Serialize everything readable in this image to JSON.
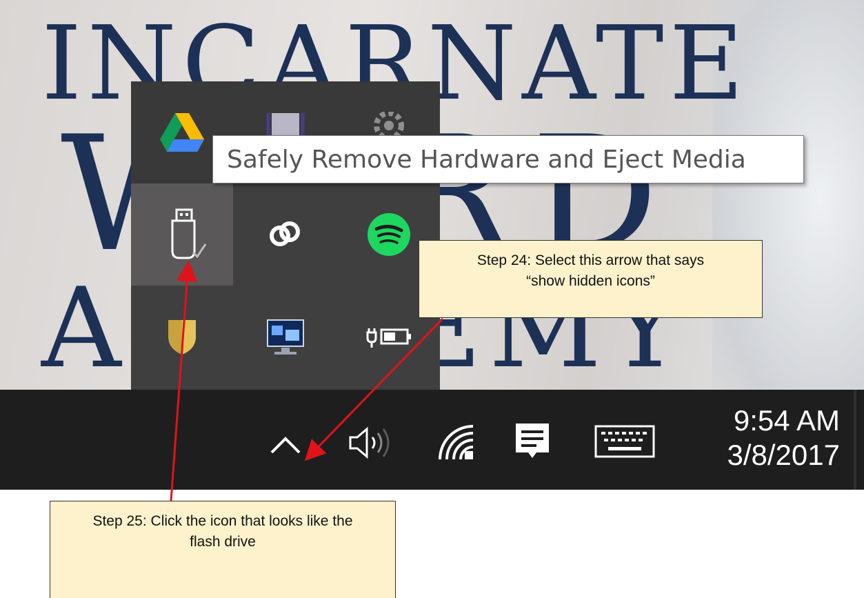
{
  "wallpaper": {
    "line1": "INCARNATE",
    "line2": "WORD",
    "line3": "ACADEMY"
  },
  "tray_popup": {
    "icons": [
      {
        "name": "google-drive-icon"
      },
      {
        "name": "window-icon"
      },
      {
        "name": "gear-icon"
      },
      {
        "name": "usb-flash-drive-icon"
      },
      {
        "name": "creative-cloud-icon"
      },
      {
        "name": "spotify-icon"
      },
      {
        "name": "security-shield-icon"
      },
      {
        "name": "display-monitor-icon"
      },
      {
        "name": "power-battery-icon"
      }
    ]
  },
  "tooltip": {
    "text": "Safely Remove Hardware and Eject Media"
  },
  "taskbar": {
    "time": "9:54 AM",
    "date": "3/8/2017"
  },
  "annotations": {
    "step24": {
      "line1": "Step 24: Select this arrow that says",
      "line2": "“show hidden icons”"
    },
    "step25": {
      "line1": "Step 25: Click the icon that looks like the",
      "line2": "flash drive"
    },
    "arrow_color": "#e0131b"
  },
  "colors": {
    "popup_bg": "#403f3f",
    "taskbar_bg": "#1e1e1e",
    "callout_bg": "#fdf2cc",
    "spotify_green": "#1ed760"
  }
}
